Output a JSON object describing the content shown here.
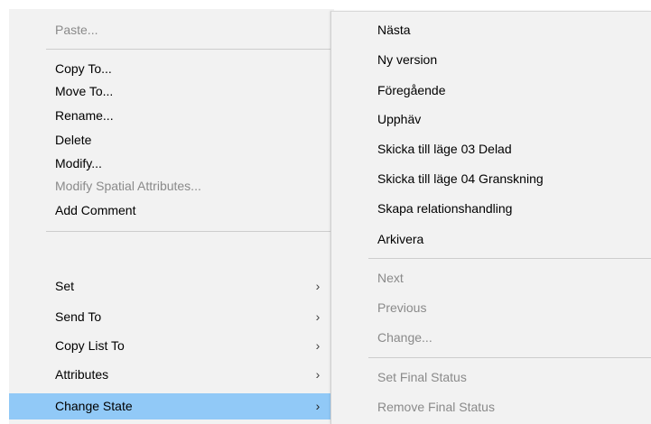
{
  "main_menu": {
    "items": [
      {
        "label": "Paste...",
        "enabled": false
      },
      {
        "label": "Copy To...",
        "enabled": true
      },
      {
        "label": "Move To...",
        "enabled": true
      },
      {
        "label": "Rename...",
        "enabled": true
      },
      {
        "label": "Delete",
        "enabled": true
      },
      {
        "label": "Modify...",
        "enabled": true
      },
      {
        "label": "Modify Spatial Attributes...",
        "enabled": false
      },
      {
        "label": "Add Comment",
        "enabled": true
      },
      {
        "label": "Set",
        "enabled": true,
        "submenu": true
      },
      {
        "label": "Send To",
        "enabled": true,
        "submenu": true
      },
      {
        "label": "Copy List To",
        "enabled": true,
        "submenu": true
      },
      {
        "label": "Attributes",
        "enabled": true,
        "submenu": true
      },
      {
        "label": "Change State",
        "enabled": true,
        "submenu": true,
        "selected": true
      }
    ],
    "submenu_arrow_icon": "chevron-right-icon",
    "highlight_color": "#91c9f7"
  },
  "sub_menu": {
    "items": [
      {
        "label": "Nästa",
        "enabled": true
      },
      {
        "label": "Ny version",
        "enabled": true
      },
      {
        "label": "Föregående",
        "enabled": true
      },
      {
        "label": "Upphäv",
        "enabled": true
      },
      {
        "label": "Skicka till läge 03 Delad",
        "enabled": true
      },
      {
        "label": "Skicka till läge 04 Granskning",
        "enabled": true
      },
      {
        "label": "Skapa relationshandling",
        "enabled": true
      },
      {
        "label": "Arkivera",
        "enabled": true
      },
      {
        "label": "Next",
        "enabled": false
      },
      {
        "label": "Previous",
        "enabled": false
      },
      {
        "label": "Change...",
        "enabled": false
      },
      {
        "label": "Set Final Status",
        "enabled": false
      },
      {
        "label": "Remove Final Status",
        "enabled": false
      }
    ]
  }
}
